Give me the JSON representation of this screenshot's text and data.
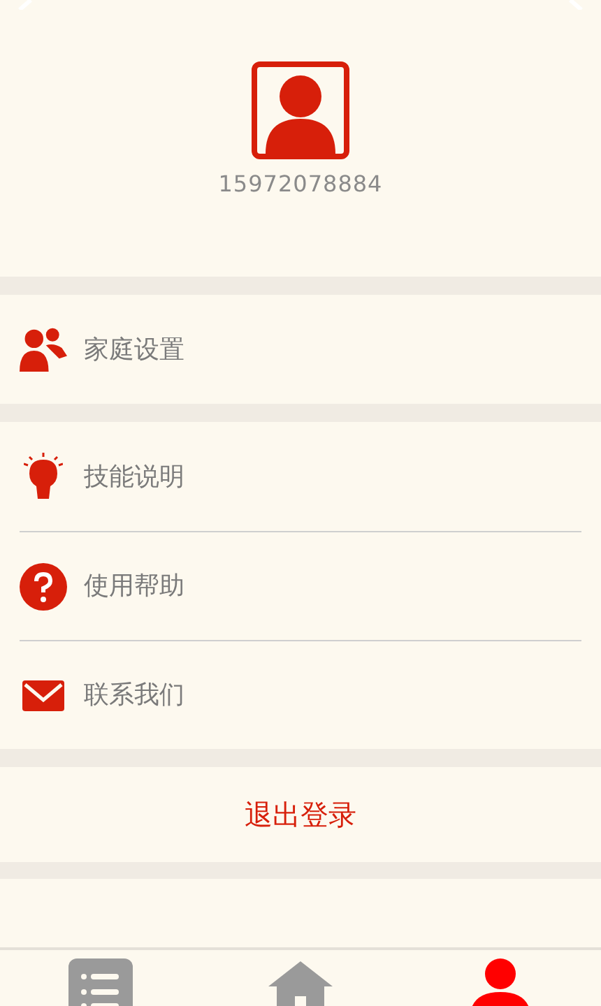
{
  "profile": {
    "phone": "15972078884"
  },
  "groups": [
    [
      {
        "kind": "family",
        "label": "家庭设置"
      }
    ],
    [
      {
        "kind": "skills",
        "label": "技能说明"
      },
      {
        "kind": "help",
        "label": "使用帮助"
      },
      {
        "kind": "contact",
        "label": "联系我们"
      }
    ]
  ],
  "logout": {
    "label": "退出登录"
  },
  "tabs": [
    {
      "kind": "list",
      "selected": false
    },
    {
      "kind": "home",
      "selected": false
    },
    {
      "kind": "profile",
      "selected": true
    }
  ]
}
